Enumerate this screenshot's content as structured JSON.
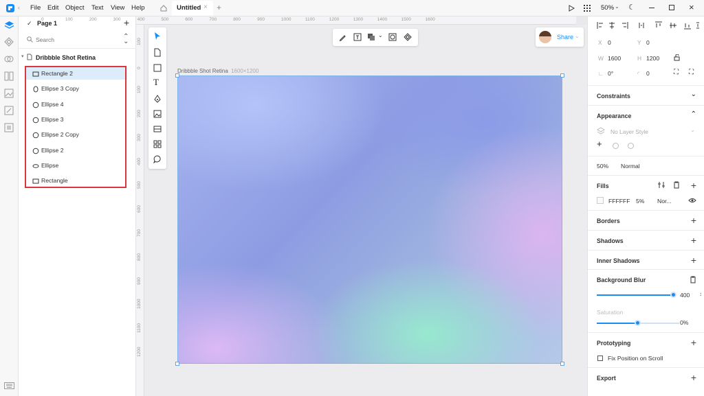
{
  "titlebar": {
    "menu": [
      "File",
      "Edit",
      "Object",
      "Text",
      "View",
      "Help"
    ],
    "tab_title": "Untitled",
    "zoom": "50%"
  },
  "layers": {
    "page_label": "Page 1",
    "search_placeholder": "Search",
    "artboard_name": "Dribbble Shot Retina",
    "items": [
      {
        "name": "Rectangle 2",
        "shape": "rect"
      },
      {
        "name": "Ellipse 3 Copy",
        "shape": "ellipse-tall"
      },
      {
        "name": "Ellipse 4",
        "shape": "circle"
      },
      {
        "name": "Ellipse 3",
        "shape": "circle"
      },
      {
        "name": "Ellipse 2 Copy",
        "shape": "circle"
      },
      {
        "name": "Ellipse 2",
        "shape": "circle"
      },
      {
        "name": "Ellipse",
        "shape": "ellipse-wide"
      },
      {
        "name": "Rectangle",
        "shape": "rect"
      }
    ]
  },
  "rulers": {
    "top": [
      "0",
      "100",
      "200",
      "300",
      "400",
      "500",
      "600",
      "700",
      "800",
      "900",
      "1000",
      "1100",
      "1200",
      "1300",
      "1400",
      "1500",
      "1600"
    ],
    "left": [
      "100",
      "0",
      "100",
      "200",
      "300",
      "400",
      "500",
      "600",
      "700",
      "800",
      "900",
      "1000",
      "1100",
      "1200"
    ]
  },
  "canvas": {
    "artboard_label": "Dribbble Shot Retina",
    "artboard_size": "1600×1200",
    "share_label": "Share"
  },
  "inspector": {
    "x": "0",
    "y": "0",
    "w": "1600",
    "h": "1200",
    "rotation": "0°",
    "radius": "0",
    "constraints": "Constraints",
    "appearance": "Appearance",
    "layer_style": "No Layer Style",
    "opacity": "50%",
    "blend": "Normal",
    "fills": "Fills",
    "fill_hex": "FFFFFF",
    "fill_opacity": "5%",
    "fill_blend": "Nor...",
    "borders": "Borders",
    "shadows": "Shadows",
    "inner_shadows": "Inner Shadows",
    "background_blur": "Background Blur",
    "blur_value": "400",
    "blur_fraction": 1.0,
    "saturation": "Saturation",
    "saturation_value": "0%",
    "saturation_fraction": 0.5,
    "prototyping": "Prototyping",
    "fix_position": "Fix Position on Scroll",
    "export": "Export"
  },
  "colors": {
    "accent": "#1a8bf0",
    "selection_border": "#d9363e",
    "layer_selected_bg": "#dcecfb"
  }
}
